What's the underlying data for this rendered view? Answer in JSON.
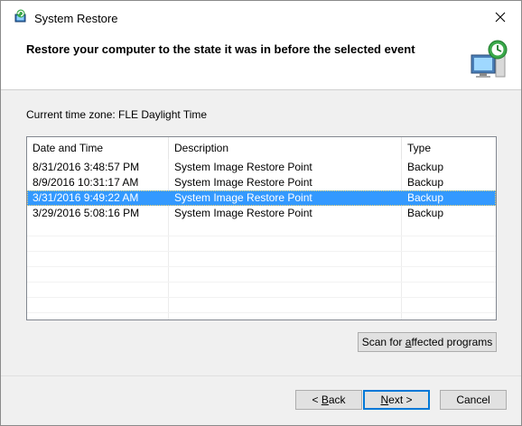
{
  "window": {
    "title": "System Restore",
    "heading": "Restore your computer to the state it was in before the selected event"
  },
  "timezone": "Current time zone: FLE Daylight Time",
  "table": {
    "columns": [
      "Date and Time",
      "Description",
      "Type"
    ],
    "rows": [
      {
        "date": "8/31/2016 3:48:57 PM",
        "description": "System Image Restore Point",
        "type": "Backup",
        "selected": false
      },
      {
        "date": "8/9/2016 10:31:17 AM",
        "description": "System Image Restore Point",
        "type": "Backup",
        "selected": false
      },
      {
        "date": "3/31/2016 9:49:22 AM",
        "description": "System Image Restore Point",
        "type": "Backup",
        "selected": true
      },
      {
        "date": "3/29/2016 5:08:16 PM",
        "description": "System Image Restore Point",
        "type": "Backup",
        "selected": false
      }
    ],
    "sort_indicator": "chevron-down-icon"
  },
  "buttons": {
    "scan_prefix": "Scan for ",
    "scan_underline": "a",
    "scan_suffix": "ffected programs",
    "back_prefix": "< ",
    "back_underline": "B",
    "back_suffix": "ack",
    "next_underline": "N",
    "next_suffix": "ext >",
    "cancel": "Cancel"
  },
  "colors": {
    "selection": "#3399ff",
    "default_button_border": "#0078d7"
  },
  "icons": {
    "app": "system-restore-icon",
    "header": "system-restore-computer-icon",
    "close": "close-icon"
  }
}
